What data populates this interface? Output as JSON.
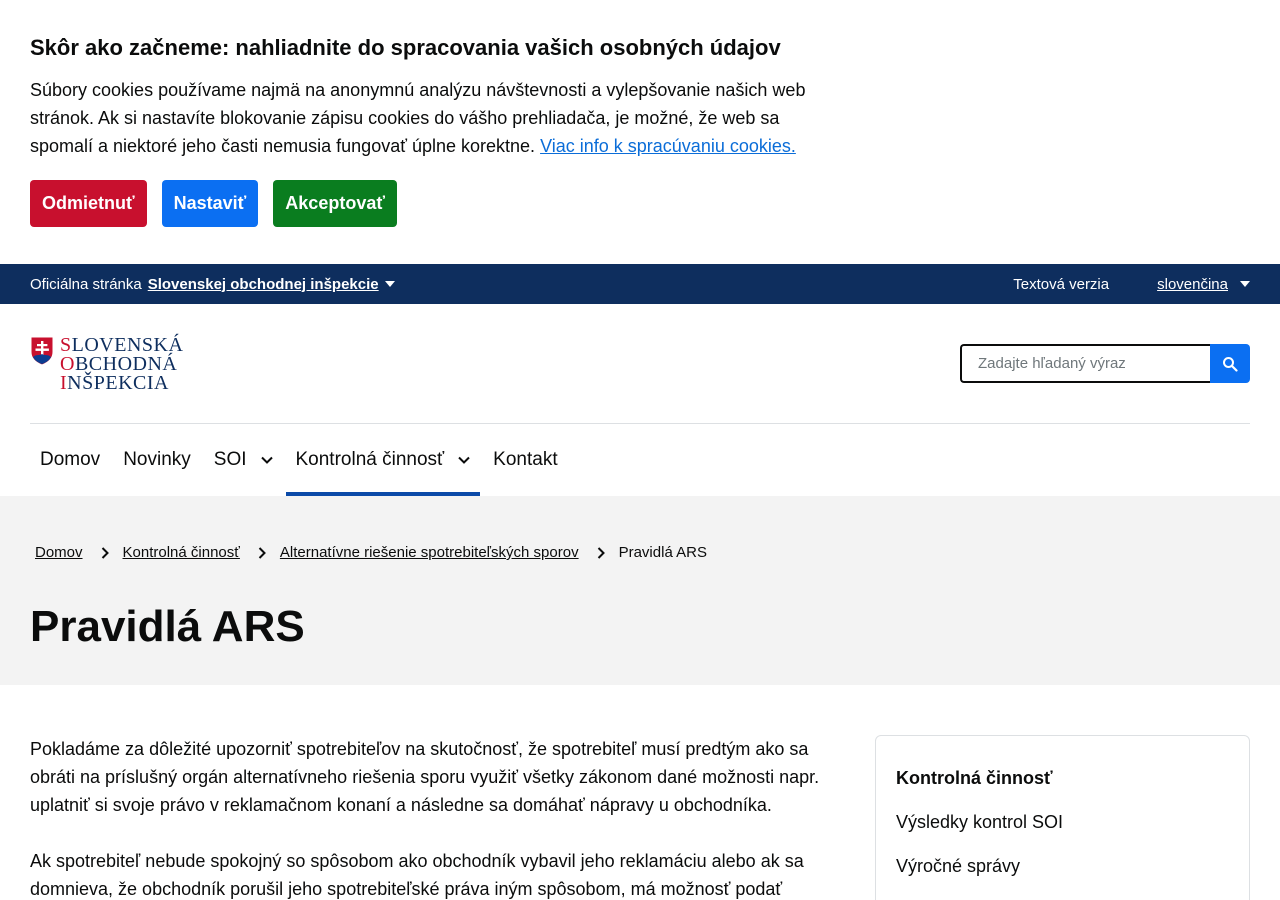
{
  "cookie": {
    "title": "Skôr ako začneme: nahliadnite do spracovania vašich osobných údajov",
    "text": "Súbory cookies používame najmä na anonymnú analýzu návštevnosti a vylepšovanie našich web stránok. Ak si nastavíte blokovanie zápisu cookies do vášho prehliadača, je možné, že web sa spomalí a niektoré jeho časti nemusia fungovať úplne korektne.",
    "link": "Viac info k spracúvaniu cookies.",
    "buttons": {
      "reject": "Odmietnuť",
      "settings": "Nastaviť",
      "accept": "Akceptovať"
    },
    "colors": {
      "reject": "#c8102e",
      "settings": "#0b6ff2",
      "accept": "#0a7d1f"
    }
  },
  "official_bar": {
    "label": "Oficiálna stránka",
    "org": "Slovenskej obchodnej inšpekcie",
    "text_version": "Textová verzia",
    "language": "slovenčina",
    "color": "#0e2e5e"
  },
  "logo": {
    "line1_initial": "S",
    "line1_rest": "LOVENSKÁ",
    "line2_initial": "O",
    "line2_rest": "BCHODNÁ",
    "line3_initial": "I",
    "line3_rest": "NŠPEKCIA"
  },
  "search": {
    "placeholder": "Zadajte hľadaný výraz",
    "icon": "search-icon"
  },
  "nav": {
    "items": [
      {
        "label": "Domov",
        "dropdown": false,
        "active": false
      },
      {
        "label": "Novinky",
        "dropdown": false,
        "active": false
      },
      {
        "label": "SOI",
        "dropdown": true,
        "active": false
      },
      {
        "label": "Kontrolná činnosť",
        "dropdown": true,
        "active": true
      },
      {
        "label": "Kontakt",
        "dropdown": false,
        "active": false
      }
    ]
  },
  "breadcrumb": {
    "items": [
      "Domov",
      "Kontrolná činnosť",
      "Alternatívne riešenie spotrebiteľských sporov"
    ],
    "current": "Pravidlá ARS"
  },
  "page": {
    "title": "Pravidlá ARS",
    "paragraphs": [
      "Pokladáme za dôležité upozorniť spotrebiteľov na skutočnosť, že spotrebiteľ musí predtým ako sa obráti na príslušný orgán alternatívneho riešenia sporu využiť všetky zákonom dané možnosti napr. uplatniť si svoje právo v reklamačnom konaní a následne sa domáhať nápravy u obchodníka.",
      "Ak spotrebiteľ nebude spokojný so spôsobom ako obchodník vybavil jeho reklamáciu alebo ak sa domnieva, že obchodník porušil jeho spotrebiteľské práva iným spôsobom, má možnosť podať návrh"
    ]
  },
  "side_panel": {
    "title": "Kontrolná činnosť",
    "links": [
      "Výsledky kontrol SOI",
      "Výročné správy"
    ]
  }
}
